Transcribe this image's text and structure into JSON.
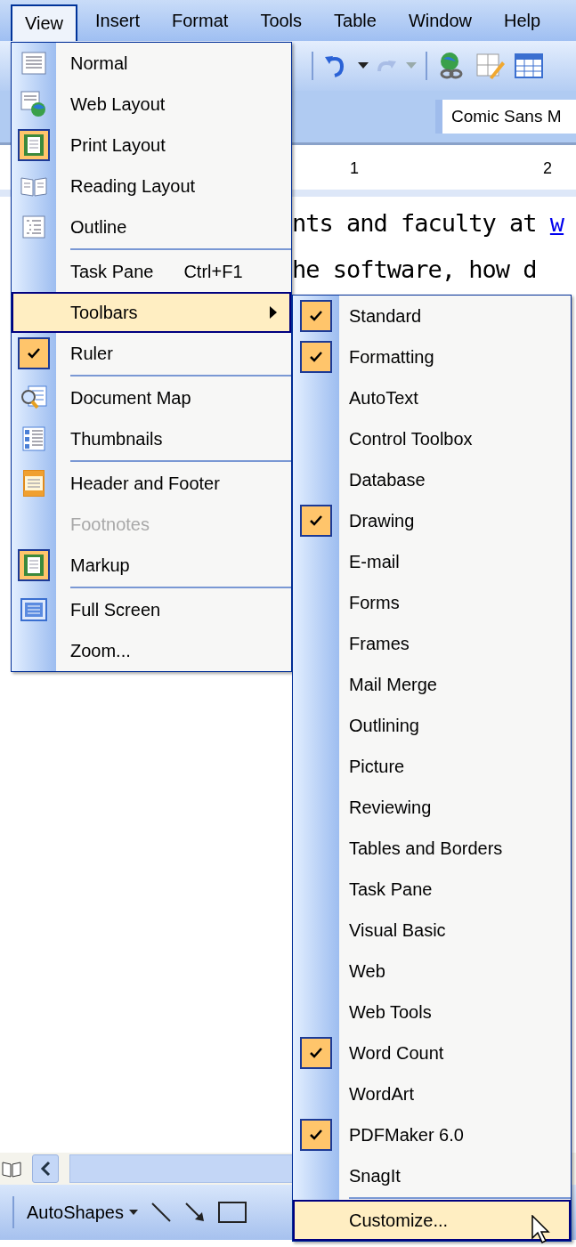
{
  "menu_bar": [
    {
      "label": "View",
      "selected": true
    },
    {
      "label": "Insert",
      "selected": false
    },
    {
      "label": "Format",
      "selected": false
    },
    {
      "label": "Tools",
      "selected": false
    },
    {
      "label": "Table",
      "selected": false
    },
    {
      "label": "Window",
      "selected": false
    },
    {
      "label": "Help",
      "selected": false
    }
  ],
  "font_field": {
    "value": "Comic Sans M"
  },
  "ruler": {
    "labels": [
      "1",
      "2"
    ]
  },
  "document": {
    "lines": [
      {
        "text": "nts and faculty at ",
        "link": "w"
      },
      {
        "text": "he software, how d"
      }
    ]
  },
  "drawing_toolbar": {
    "autoshapes": "AutoShapes"
  },
  "view_menu": [
    {
      "kind": "item",
      "label": "Normal",
      "checked": false,
      "disabled": false,
      "selected": false
    },
    {
      "kind": "item",
      "label": "Web Layout",
      "checked": false,
      "disabled": false,
      "selected": false
    },
    {
      "kind": "item",
      "label": "Print Layout",
      "checked": true,
      "disabled": false,
      "selected": false
    },
    {
      "kind": "item",
      "label": "Reading Layout",
      "checked": false,
      "disabled": false,
      "selected": false
    },
    {
      "kind": "item",
      "label": "Outline",
      "checked": false,
      "disabled": false,
      "selected": false
    },
    {
      "kind": "separator"
    },
    {
      "kind": "item",
      "label": "Task Pane",
      "shortcut": "Ctrl+F1",
      "checked": false,
      "disabled": false,
      "selected": false
    },
    {
      "kind": "item",
      "label": "Toolbars",
      "submenu": true,
      "checked": false,
      "disabled": false,
      "selected": true
    },
    {
      "kind": "item",
      "label": "Ruler",
      "checked": true,
      "disabled": false,
      "selected": false
    },
    {
      "kind": "separator"
    },
    {
      "kind": "item",
      "label": "Document Map",
      "checked": false,
      "disabled": false,
      "selected": false
    },
    {
      "kind": "item",
      "label": "Thumbnails",
      "checked": false,
      "disabled": false,
      "selected": false
    },
    {
      "kind": "separator"
    },
    {
      "kind": "item",
      "label": "Header and Footer",
      "checked": false,
      "disabled": false,
      "selected": false
    },
    {
      "kind": "item",
      "label": "Footnotes",
      "checked": false,
      "disabled": true,
      "selected": false
    },
    {
      "kind": "item",
      "label": "Markup",
      "checked": true,
      "disabled": false,
      "selected": false
    },
    {
      "kind": "separator"
    },
    {
      "kind": "item",
      "label": "Full Screen",
      "checked": false,
      "disabled": false,
      "selected": false
    },
    {
      "kind": "item",
      "label": "Zoom...",
      "checked": false,
      "disabled": false,
      "selected": false
    }
  ],
  "toolbars_menu": [
    {
      "kind": "item",
      "label": "Standard",
      "checked": true,
      "selected": false
    },
    {
      "kind": "item",
      "label": "Formatting",
      "checked": true,
      "selected": false
    },
    {
      "kind": "item",
      "label": "AutoText",
      "checked": false,
      "selected": false
    },
    {
      "kind": "item",
      "label": "Control Toolbox",
      "checked": false,
      "selected": false
    },
    {
      "kind": "item",
      "label": "Database",
      "checked": false,
      "selected": false
    },
    {
      "kind": "item",
      "label": "Drawing",
      "checked": true,
      "selected": false
    },
    {
      "kind": "item",
      "label": "E-mail",
      "checked": false,
      "selected": false
    },
    {
      "kind": "item",
      "label": "Forms",
      "checked": false,
      "selected": false
    },
    {
      "kind": "item",
      "label": "Frames",
      "checked": false,
      "selected": false
    },
    {
      "kind": "item",
      "label": "Mail Merge",
      "checked": false,
      "selected": false
    },
    {
      "kind": "item",
      "label": "Outlining",
      "checked": false,
      "selected": false
    },
    {
      "kind": "item",
      "label": "Picture",
      "checked": false,
      "selected": false
    },
    {
      "kind": "item",
      "label": "Reviewing",
      "checked": false,
      "selected": false
    },
    {
      "kind": "item",
      "label": "Tables and Borders",
      "checked": false,
      "selected": false
    },
    {
      "kind": "item",
      "label": "Task Pane",
      "checked": false,
      "selected": false
    },
    {
      "kind": "item",
      "label": "Visual Basic",
      "checked": false,
      "selected": false
    },
    {
      "kind": "item",
      "label": "Web",
      "checked": false,
      "selected": false
    },
    {
      "kind": "item",
      "label": "Web Tools",
      "checked": false,
      "selected": false
    },
    {
      "kind": "item",
      "label": "Word Count",
      "checked": true,
      "selected": false
    },
    {
      "kind": "item",
      "label": "WordArt",
      "checked": false,
      "selected": false
    },
    {
      "kind": "item",
      "label": "PDFMaker 6.0",
      "checked": true,
      "selected": false
    },
    {
      "kind": "item",
      "label": "SnagIt",
      "checked": false,
      "selected": false
    },
    {
      "kind": "separator"
    },
    {
      "kind": "item",
      "label": "Customize...",
      "checked": false,
      "selected": true
    }
  ]
}
